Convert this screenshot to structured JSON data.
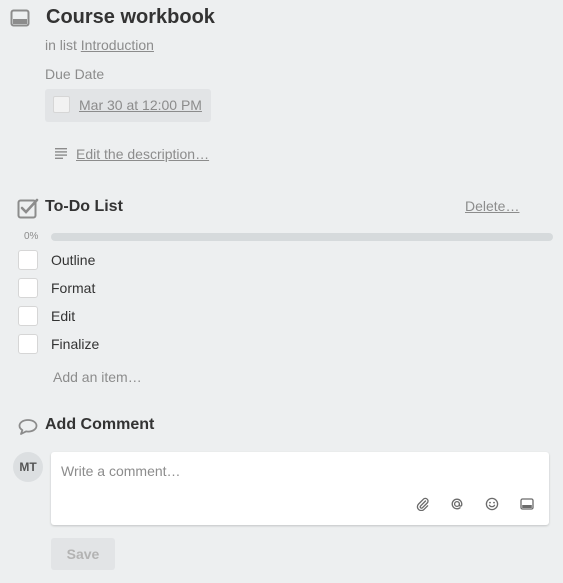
{
  "card": {
    "title": "Course workbook",
    "in_list_prefix": "in list",
    "list_name": "Introduction"
  },
  "due": {
    "label": "Due Date",
    "value": "Mar 30 at 12:00 PM",
    "completed": false
  },
  "description": {
    "edit_link": "Edit the description…"
  },
  "checklist": {
    "title": "To-Do List",
    "delete_label": "Delete…",
    "progress_label": "0%",
    "progress": 0,
    "items": [
      {
        "label": "Outline",
        "checked": false
      },
      {
        "label": "Format",
        "checked": false
      },
      {
        "label": "Edit",
        "checked": false
      },
      {
        "label": "Finalize",
        "checked": false
      }
    ],
    "add_item_label": "Add an item…"
  },
  "comment": {
    "title": "Add Comment",
    "avatar_initials": "MT",
    "placeholder": "Write a comment…",
    "tools": [
      "attachment-icon",
      "mention-icon",
      "emoji-icon",
      "card-icon"
    ],
    "save_label": "Save"
  },
  "colors": {
    "background": "#edeff0",
    "muted_text": "#8c8c8c",
    "progress_track": "#d6dadc",
    "progress_fill": "#5aac44"
  }
}
